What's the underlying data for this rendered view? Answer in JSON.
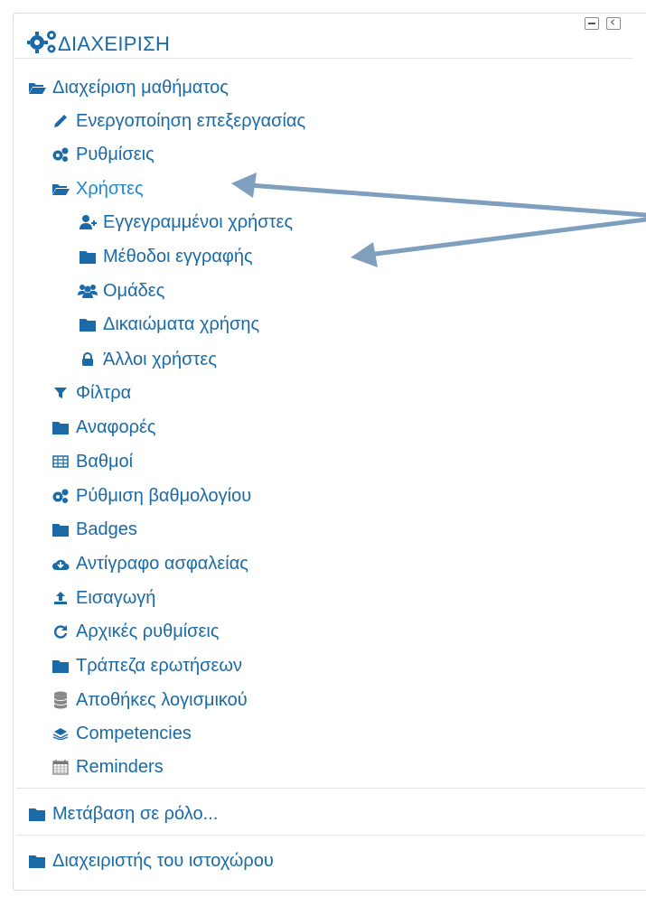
{
  "header": {
    "title": "ΔΙΑΧΕΙΡΙΣΗ"
  },
  "course_admin": {
    "label": "Διαχείριση μαθήματος",
    "items": {
      "edit": "Ενεργοποίηση επεξεργασίας",
      "settings": "Ρυθμίσεις",
      "users": "Χρήστες",
      "enrolled": "Εγγεγραμμένοι χρήστες",
      "enrol_methods": "Μέθοδοι εγγραφής",
      "groups": "Ομάδες",
      "permissions": "Δικαιώματα χρήσης",
      "other_users": "Άλλοι χρήστες",
      "filters": "Φίλτρα",
      "reports": "Αναφορές",
      "grades": "Βαθμοί",
      "gradebook_setup": "Ρύθμιση βαθμολογίου",
      "badges": "Badges",
      "backup": "Αντίγραφο ασφαλείας",
      "import": "Εισαγωγή",
      "reset": "Αρχικές ρυθμίσεις",
      "question_bank": "Τράπεζα ερωτήσεων",
      "repositories": "Αποθήκες λογισμικού",
      "competencies": "Competencies",
      "reminders": "Reminders"
    }
  },
  "switch_role": "Μετάβαση σε ρόλο...",
  "site_admin": "Διαχειριστής του ιστοχώρου",
  "colors": {
    "link": "#1a6aa7",
    "active": "#1e88d6",
    "annotation_arrow": "#7f9fbf"
  }
}
